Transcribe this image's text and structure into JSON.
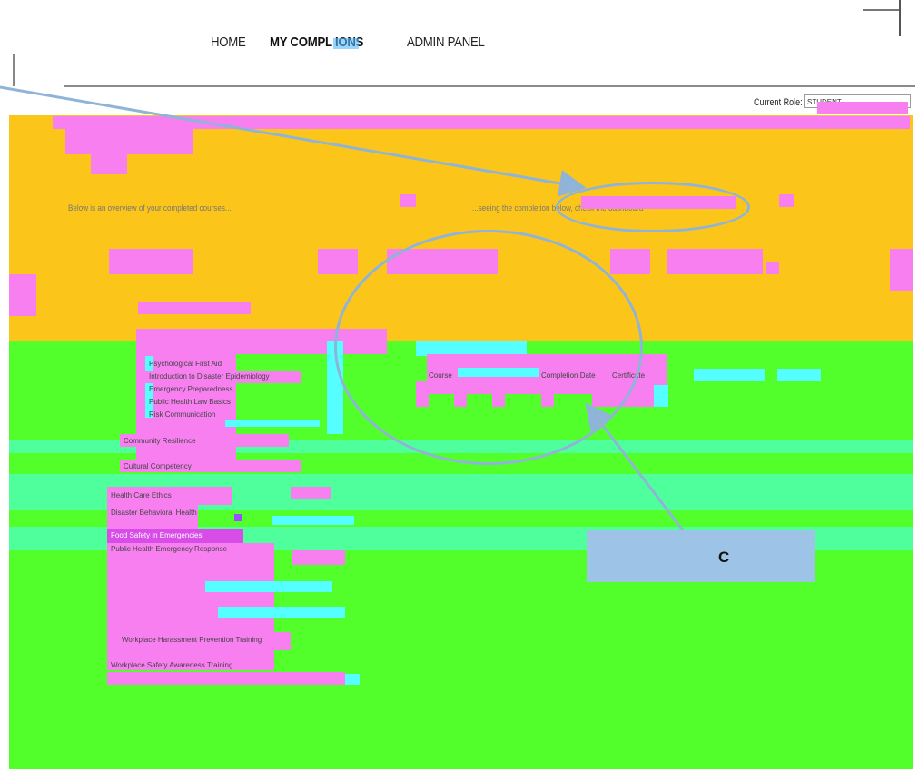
{
  "nav": {
    "home": "HOME",
    "my_completions": "MY COMPL   IONS",
    "admin_panel": "ADMIN PANEL"
  },
  "role": {
    "label": "Current Role:",
    "value": "STUDENT"
  },
  "content": {
    "intro_left": "Below is an overview of your completed courses...",
    "intro_right": "...seeing the completion below, check the dashboard",
    "col_course": "Course",
    "col_completion": "Completion Date",
    "col_certificate": "Certificate"
  },
  "sidebar_links": [
    "Psychological First Aid",
    "Introduction to Disaster Epidemiology",
    "Emergency Preparedness",
    "Public Health Law Basics",
    "Risk Communication",
    "Community Resilience",
    "Cultural Competency",
    "Health Care Ethics",
    "Disaster Behavioral Health",
    "Food Safety in Emergencies",
    "Public Health Emergency Response",
    "Workplace Harassment Prevention Training",
    "Workplace Safety Awareness Training"
  ],
  "callout": {
    "letter": "C"
  },
  "colors": {
    "orange": "#fcc51a",
    "green": "#53ff2b",
    "pink": "#f77ff0",
    "cyan": "#55ffff",
    "teal": "#4dffaf",
    "callout": "#9dc3e6",
    "annotation_line": "#8fb4d8"
  }
}
